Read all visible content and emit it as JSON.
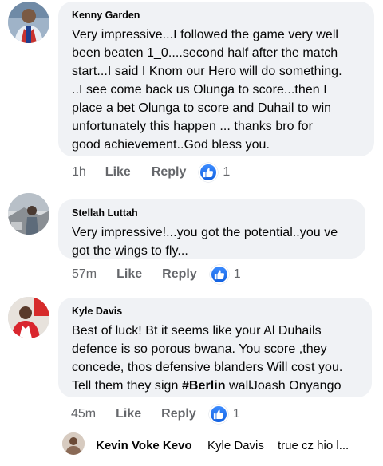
{
  "comments": [
    {
      "author": "Kenny Garden",
      "avatar_icon": "player-photo-avatar",
      "lines": [
        "Very impressive...I followed the game very well",
        "been beaten 1_0....second half after the match",
        "start...I said I Knom our Hero will do something.",
        "..I see come back us Olunga to score...then I",
        "place a bet Olunga to score and Duhail to win",
        "unfortunately this happen ... thanks bro for",
        "good achievement..God bless you."
      ],
      "time": "1h",
      "like_label": "Like",
      "reply_label": "Reply",
      "reaction_count": "1"
    },
    {
      "author": "Stellah Luttah",
      "avatar_icon": "outdoor-photo-avatar",
      "lines": [
        "Very impressive!...you got the potential..you ve",
        "got the wings to fly..."
      ],
      "time": "57m",
      "like_label": "Like",
      "reply_label": "Reply",
      "reaction_count": "1"
    },
    {
      "author": "Kyle Davis",
      "avatar_icon": "red-jersey-photo-avatar",
      "lines": [
        "Best of luck! Bt it seems like your Al Duhails",
        "defence is so porous bwana. You score ,they",
        "concede, thos defensive blanders Will cost you."
      ],
      "last_line_pre": "Tell them they sign ",
      "last_line_hashtag": "#Berlin",
      "last_line_post": " wallJoash Onyango",
      "time": "45m",
      "like_label": "Like",
      "reply_label": "Reply",
      "reaction_count": "1"
    }
  ],
  "reply_preview": {
    "author": "Kevin Voke Kevo",
    "tag": "Kyle Davis",
    "snippet": "true cz hio l..."
  },
  "colors": {
    "bubble": "#f0f2f5",
    "meta": "#65676b",
    "like_blue": "#1877f2"
  }
}
